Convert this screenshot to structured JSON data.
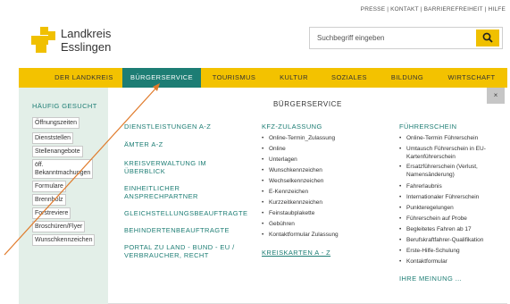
{
  "utility": {
    "items": [
      "PRESSE",
      "KONTAKT",
      "BARRIEREFREIHEIT",
      "HILFE"
    ],
    "separator": "|"
  },
  "logo": {
    "line1": "Landkreis",
    "line2": "Esslingen",
    "color": "#f0c000"
  },
  "search": {
    "placeholder": "Suchbegriff eingeben",
    "icon": "search-icon"
  },
  "nav": {
    "items": [
      "DER LANDKREIS",
      "BÜRGERSERVICE",
      "TOURISMUS",
      "KULTUR",
      "SOZIALES",
      "BILDUNG",
      "WIRTSCHAFT"
    ],
    "active": "BÜRGERSERVICE",
    "bar_color": "#f3c200",
    "active_color": "#1d7d74"
  },
  "panel": {
    "title": "BÜRGERSERVICE",
    "close_label": "×",
    "sidebar": {
      "heading": "HÄUFIG GESUCHT",
      "tags": [
        "Öffnungszeiten",
        "Dienststellen",
        "Stellenangebote",
        "öff.",
        "Bekanntmachungen",
        "Formulare",
        "Brennholz",
        "Forstreviere",
        "Broschüren/Flyer",
        "Wunschkennzeichen"
      ]
    },
    "col1": [
      "DIENSTLEISTUNGEN A-Z",
      "ÄMTER A-Z",
      "KREISVERWALTUNG IM",
      "ÜBERBLICK",
      "EINHEITLICHER",
      "ANSPRECHPARTNER",
      "GLEICHSTELLUNGSBEAUFTRAGTE",
      "BEHINDERTENBEAUFTRAGTE",
      "PORTAL ZU LAND - BUND - EU /",
      "VERBRAUCHER, RECHT"
    ],
    "col2": {
      "heading": "KFZ-ZULASSUNG",
      "items": [
        "Online-Termin_Zulassung",
        "Online",
        "Unterlagen",
        "Wunschkennzeichen",
        "Wechselkennzeichen",
        "E-Kennzeichen",
        "Kurzzeitkennzeichen",
        "Feinstaubplakette",
        "Gebühren",
        "Kontaktformular Zulassung"
      ],
      "footer_link": "KREISKARTEN A - Z"
    },
    "col3": {
      "heading": "FÜHRERSCHEIN",
      "items": [
        "Online-Termin Führerschein",
        "Umtausch Führerschein in EU-",
        "Kartenführerschein",
        "Ersatzführerschein (Verlust,",
        "Namensänderung)",
        "Fahrerlaubnis",
        "Internationaler Führerschein",
        "Punkteregelungen",
        "Führerschein auf Probe",
        "Begleitetes Fahren ab 17",
        "Berufskraftfahrer-Qualifikation",
        "Erste-Hilfe-Schulung",
        "Kontaktformular"
      ],
      "footer_link": "IHRE MEINUNG ..."
    }
  },
  "annotation": {
    "color": "#e07a2a"
  }
}
